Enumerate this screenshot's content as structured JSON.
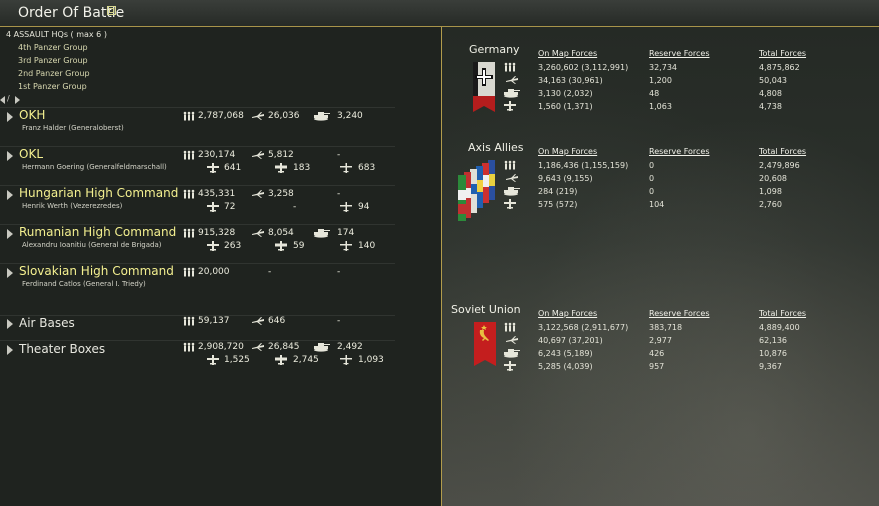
{
  "title": "Order Of Battle",
  "assault": {
    "label": "4 ASSAULT HQs ( max 6 )",
    "items": [
      "4th Panzer Group",
      "3rd Panzer Group",
      "2nd Panzer Group",
      "1st Panzer Group"
    ]
  },
  "nav_label": "/",
  "commands": [
    {
      "name": "OKH",
      "commander": "Franz Halder (Generaloberst)",
      "men": "2,787,068",
      "aircraft": "26,036",
      "tanks": "3,240",
      "fighters": "",
      "bombers": "",
      "recon": ""
    },
    {
      "name": "OKL",
      "commander": "Hermann Goering (Generalfeldmarschall)",
      "men": "230,174",
      "aircraft": "5,812",
      "tanks": "-",
      "fighters": "641",
      "bombers": "183",
      "recon": "683"
    },
    {
      "name": "Hungarian High Command",
      "commander": "Henrik Werth (Vezerezredes)",
      "men": "435,331",
      "aircraft": "3,258",
      "tanks": "-",
      "fighters": "72",
      "bombers": "-",
      "recon": "94"
    },
    {
      "name": "Rumanian High Command",
      "commander": "Alexandru Ioanitiu (General de Brigada)",
      "men": "915,328",
      "aircraft": "8,054",
      "tanks": "174",
      "fighters": "263",
      "bombers": "59",
      "recon": "140"
    },
    {
      "name": "Slovakian High Command",
      "commander": "Ferdinand Catlos (General I. Triedy)",
      "men": "20,000",
      "aircraft": "-",
      "tanks": "-",
      "fighters": "",
      "bombers": "",
      "recon": ""
    },
    {
      "name": "Air Bases",
      "commander": "",
      "men": "59,137",
      "aircraft": "646",
      "tanks": "-",
      "fighters": "",
      "bombers": "",
      "recon": ""
    },
    {
      "name": "Theater Boxes",
      "commander": "",
      "men": "2,908,720",
      "aircraft": "26,845",
      "tanks": "2,492",
      "fighters": "1,525",
      "bombers": "2,745",
      "recon": "1,093"
    }
  ],
  "columns": {
    "on_map": "On Map Forces",
    "reserve": "Reserve Forces",
    "total": "Total Forces"
  },
  "factions": [
    {
      "name": "Germany",
      "flag": "germany-flag",
      "rows": [
        {
          "on_map": "3,260,602 (3,112,991)",
          "reserve": "32,734",
          "total": "4,875,862"
        },
        {
          "on_map": "34,163 (30,961)",
          "reserve": "1,200",
          "total": "50,043"
        },
        {
          "on_map": "3,130 (2,032)",
          "reserve": "48",
          "total": "4,808"
        },
        {
          "on_map": "1,560 (1,371)",
          "reserve": "1,063",
          "total": "4,738"
        }
      ]
    },
    {
      "name": "Axis Allies",
      "flag": "axis-allies-flags",
      "rows": [
        {
          "on_map": "1,186,436 (1,155,159)",
          "reserve": "0",
          "total": "2,479,896"
        },
        {
          "on_map": "9,643 (9,155)",
          "reserve": "0",
          "total": "20,608"
        },
        {
          "on_map": "284 (219)",
          "reserve": "0",
          "total": "1,098"
        },
        {
          "on_map": "575 (572)",
          "reserve": "104",
          "total": "2,760"
        }
      ]
    },
    {
      "name": "Soviet Union",
      "flag": "soviet-flag",
      "rows": [
        {
          "on_map": "3,122,568 (2,911,677)",
          "reserve": "383,718",
          "total": "4,889,400"
        },
        {
          "on_map": "40,697 (37,201)",
          "reserve": "2,977",
          "total": "62,136"
        },
        {
          "on_map": "6,243 (5,189)",
          "reserve": "426",
          "total": "10,876"
        },
        {
          "on_map": "5,285 (4,039)",
          "reserve": "957",
          "total": "9,367"
        }
      ]
    }
  ],
  "colors": {
    "accent_gold": "#b29c4c",
    "hq_yellow": "#f4f090",
    "panel": "#1f231f"
  }
}
